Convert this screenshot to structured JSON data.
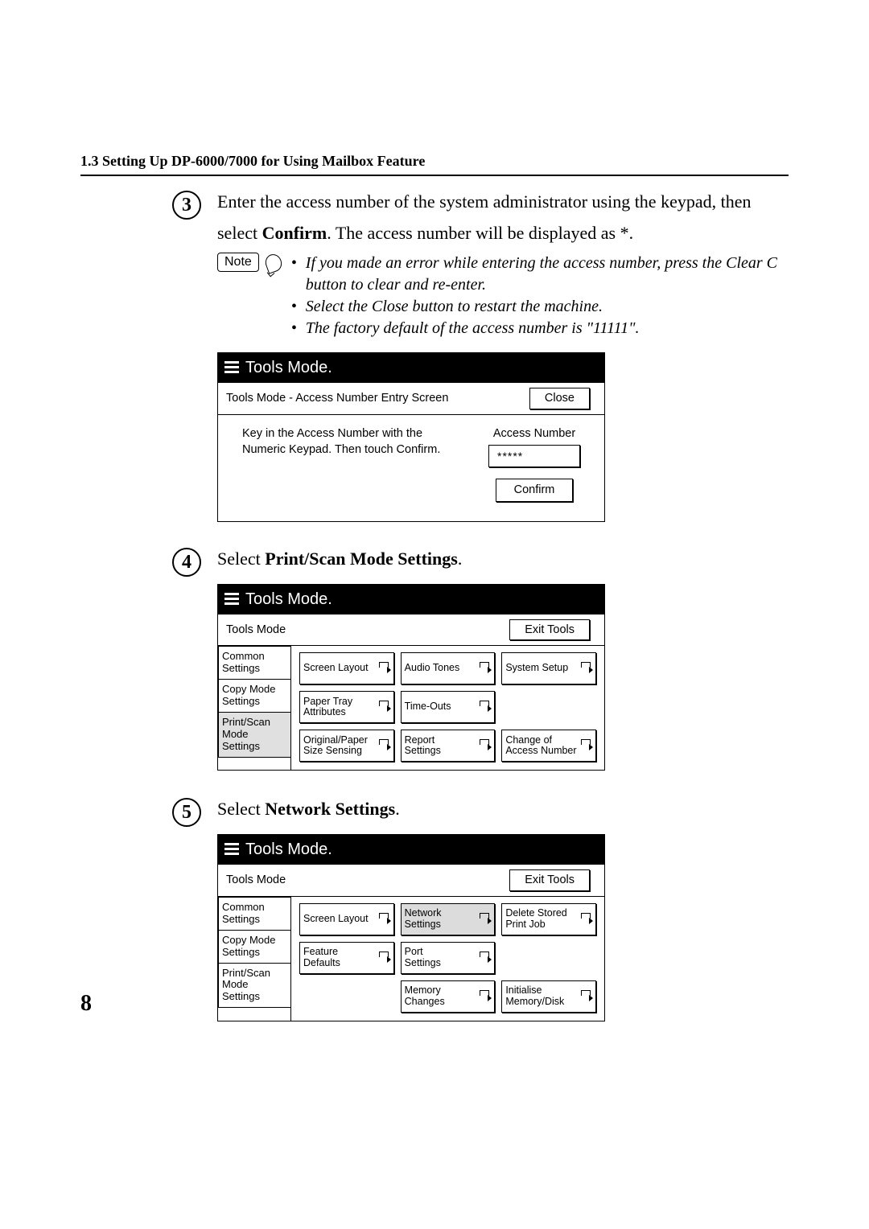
{
  "header": "1.3 Setting Up DP-6000/7000 for Using Mailbox Feature",
  "page_number": "8",
  "step3": {
    "num": "3",
    "text_a": "Enter the access number of the system administrator using the keypad, then",
    "text_b_pre": "select ",
    "text_b_bold": "Confirm",
    "text_b_post": ". The access number will be displayed as *.",
    "note_label": "Note",
    "bullets": [
      "If you made an error while entering the access number, press the Clear C button to clear and re-enter.",
      "Select the Close button to restart the machine.",
      "The factory default of the access number is \"11111\"."
    ]
  },
  "screen1": {
    "title": "Tools Mode.",
    "crumb": "Tools Mode - Access Number Entry Screen",
    "close": "Close",
    "instr_a": "Key in the Access Number with the",
    "instr_b": "Numeric Keypad.  Then touch Confirm.",
    "field_label": "Access Number",
    "field_value": "*****",
    "confirm": "Confirm"
  },
  "step4": {
    "num": "4",
    "text_pre": "Select ",
    "text_bold": "Print/Scan Mode Settings",
    "text_post": "."
  },
  "screen2": {
    "title": "Tools Mode.",
    "crumb": "Tools Mode",
    "exit": "Exit Tools",
    "tabs": [
      "Common\nSettings",
      "Copy Mode\nSettings",
      "Print/Scan\nMode Settings"
    ],
    "r1c1": "Screen Layout",
    "r1c2": "Audio Tones",
    "r1c3": "System Setup",
    "r2c1a": "Paper Tray",
    "r2c1b": "Attributes",
    "r2c2": "Time-Outs",
    "r3c1a": "Original/Paper",
    "r3c1b": "Size Sensing",
    "r3c2a": "Report",
    "r3c2b": "Settings",
    "r3c3a": "Change of",
    "r3c3b": "Access Number"
  },
  "step5": {
    "num": "5",
    "text_pre": "Select ",
    "text_bold": "Network Settings",
    "text_post": "."
  },
  "screen3": {
    "title": "Tools Mode.",
    "crumb": "Tools Mode",
    "exit": "Exit Tools",
    "tabs": [
      "Common\nSettings",
      "Copy Mode\nSettings",
      "Print/Scan\nMode Settings"
    ],
    "r1c1": "Screen Layout",
    "r1c2a": "Network",
    "r1c2b": "Settings",
    "r1c3a": "Delete Stored",
    "r1c3b": "Print Job",
    "r2c1a": "Feature",
    "r2c1b": "Defaults",
    "r2c2a": "Port",
    "r2c2b": "Settings",
    "r3c2a": "Memory",
    "r3c2b": "Changes",
    "r3c3a": "Initialise",
    "r3c3b": "Memory/Disk"
  }
}
